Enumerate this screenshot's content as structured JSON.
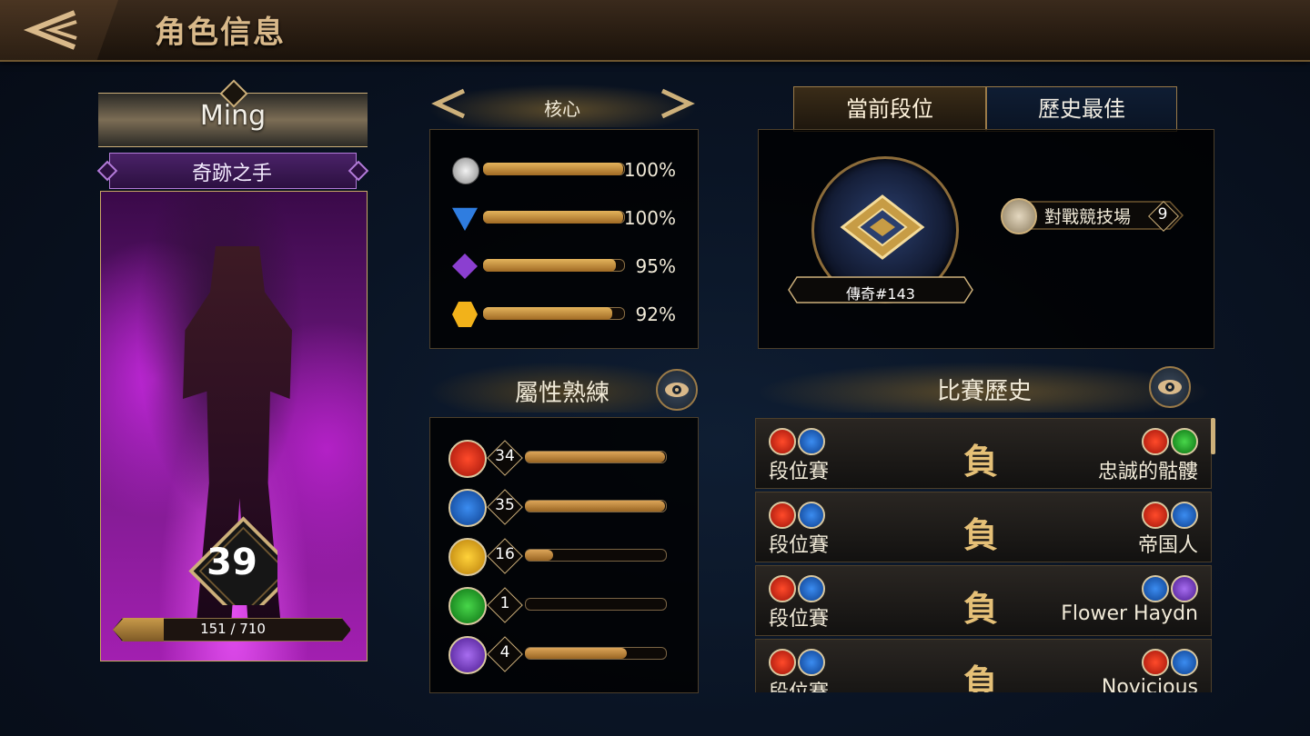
{
  "header": {
    "title": "角色信息"
  },
  "character": {
    "name": "Ming",
    "class_name": "奇跡之手",
    "level": "39",
    "xp_text": "151 / 710",
    "xp_fraction": 0.2127
  },
  "core": {
    "title": "核心",
    "rows": [
      {
        "icon": "silver-coin-icon",
        "percent": "100%",
        "value": 1.0,
        "color": "#c0c0c0"
      },
      {
        "icon": "blue-triangle-gem-icon",
        "percent": "100%",
        "value": 1.0,
        "color": "#2f7de0"
      },
      {
        "icon": "purple-diamond-gem-icon",
        "percent": "95%",
        "value": 0.95,
        "color": "#8b3fd0"
      },
      {
        "icon": "gold-hexagon-icon",
        "percent": "92%",
        "value": 0.92,
        "color": "#f2b21a"
      }
    ]
  },
  "attributes": {
    "title": "屬性熟練",
    "rows": [
      {
        "icon": "strength-arm-icon",
        "color_class": "ic-red",
        "value": "34",
        "fraction": 1.0
      },
      {
        "icon": "book-icon",
        "color_class": "ic-blue",
        "value": "35",
        "fraction": 1.0
      },
      {
        "icon": "lion-head-icon",
        "color_class": "ic-yellow",
        "value": "16",
        "fraction": 0.2
      },
      {
        "icon": "arrow-icon",
        "color_class": "ic-green",
        "value": "1",
        "fraction": 0.0
      },
      {
        "icon": "anvil-icon",
        "color_class": "ic-purple",
        "value": "4",
        "fraction": 0.73
      }
    ]
  },
  "rank": {
    "tab_current": "當前段位",
    "tab_best": "歷史最佳",
    "rank_label": "傳奇#143",
    "arena_name": "對戰競技場",
    "arena_count": "9"
  },
  "history": {
    "title": "比賽歷史",
    "matches": [
      {
        "type": "段位賽",
        "result": "負",
        "opponent": "忠誠的骷髏",
        "my_icons": [
          "ic-red",
          "ic-blue"
        ],
        "opp_icons": [
          "ic-red",
          "ic-green"
        ]
      },
      {
        "type": "段位賽",
        "result": "負",
        "opponent": "帝国人",
        "my_icons": [
          "ic-red",
          "ic-blue"
        ],
        "opp_icons": [
          "ic-red",
          "ic-blue"
        ]
      },
      {
        "type": "段位賽",
        "result": "負",
        "opponent": "Flower Haydn",
        "my_icons": [
          "ic-red",
          "ic-blue"
        ],
        "opp_icons": [
          "ic-blue",
          "ic-purple"
        ]
      },
      {
        "type": "段位賽",
        "result": "負",
        "opponent": "Novicious",
        "my_icons": [
          "ic-red",
          "ic-blue"
        ],
        "opp_icons": [
          "ic-red",
          "ic-blue"
        ]
      }
    ]
  },
  "colors": {
    "accent_gold": "#cdb07a",
    "bar_gold": "#dca558",
    "class_purple": "#4a2268"
  }
}
